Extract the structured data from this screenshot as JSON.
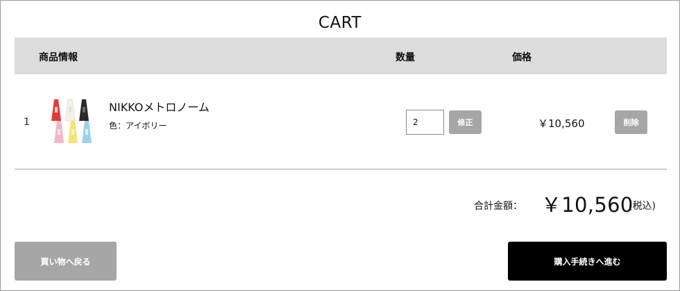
{
  "page": {
    "title": "CART"
  },
  "table": {
    "headers": {
      "info": "商品情報",
      "quantity": "数量",
      "price": "価格"
    },
    "rows": [
      {
        "index": "1",
        "image_icon": "metronome-product-image",
        "name": "NIKKOメトロノーム",
        "option": "色：アイボリー",
        "quantity": "2",
        "update_label": "修正",
        "price": "￥10,560",
        "delete_label": "削除"
      }
    ]
  },
  "summary": {
    "total_label": "合計金額：",
    "total_amount": "￥10,560",
    "tax_note": "(税込)"
  },
  "actions": {
    "back_label": "買い物へ戻る",
    "checkout_label": "購入手続きへ進む"
  },
  "colors": {
    "header_bg": "#dcdcdc",
    "gray_button": "#a6a6a6",
    "checkout_button": "#000000"
  }
}
